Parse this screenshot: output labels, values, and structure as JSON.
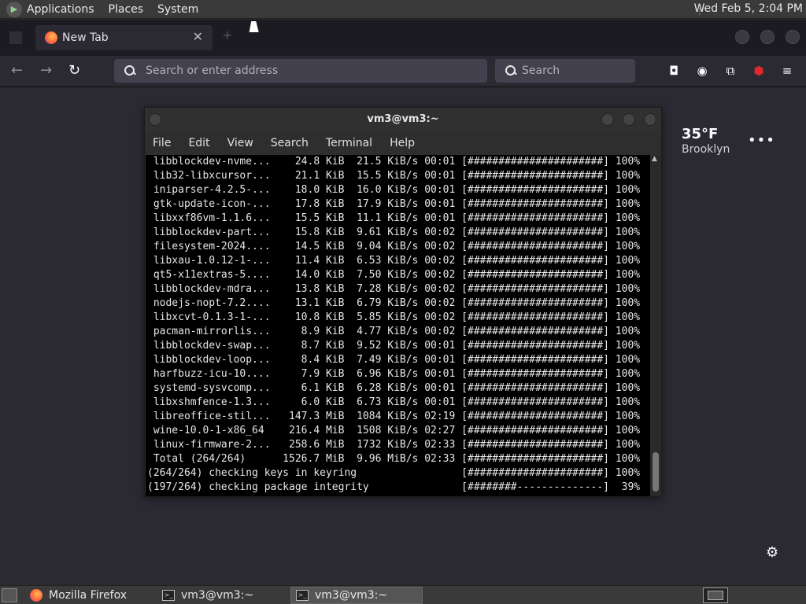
{
  "top_panel": {
    "menus": [
      "Applications",
      "Places",
      "System"
    ],
    "clock": "Wed Feb  5, 2:04 PM"
  },
  "browser": {
    "tab_title": "New Tab",
    "url_placeholder": "Search or enter address",
    "search_placeholder": "Search",
    "weather": {
      "temp": "35°F",
      "city": "Brooklyn"
    }
  },
  "terminal": {
    "title": "vm3@vm3:~",
    "menu": [
      "File",
      "Edit",
      "View",
      "Search",
      "Terminal",
      "Help"
    ],
    "lines": [
      " libblockdev-nvme...    24.8 KiB  21.5 KiB/s 00:01 [######################] 100%",
      " lib32-libxcursor...    21.1 KiB  15.5 KiB/s 00:01 [######################] 100%",
      " iniparser-4.2.5-...    18.0 KiB  16.0 KiB/s 00:01 [######################] 100%",
      " gtk-update-icon-...    17.8 KiB  17.9 KiB/s 00:01 [######################] 100%",
      " libxxf86vm-1.1.6...    15.5 KiB  11.1 KiB/s 00:01 [######################] 100%",
      " libblockdev-part...    15.8 KiB  9.61 KiB/s 00:02 [######################] 100%",
      " filesystem-2024....    14.5 KiB  9.04 KiB/s 00:02 [######################] 100%",
      " libxau-1.0.12-1-...    11.4 KiB  6.53 KiB/s 00:02 [######################] 100%",
      " qt5-x11extras-5....    14.0 KiB  7.50 KiB/s 00:02 [######################] 100%",
      " libblockdev-mdra...    13.8 KiB  7.28 KiB/s 00:02 [######################] 100%",
      " nodejs-nopt-7.2....    13.1 KiB  6.79 KiB/s 00:02 [######################] 100%",
      " libxcvt-0.1.3-1-...    10.8 KiB  5.85 KiB/s 00:02 [######################] 100%",
      " pacman-mirrorlis...     8.9 KiB  4.77 KiB/s 00:02 [######################] 100%",
      " libblockdev-swap...     8.7 KiB  9.52 KiB/s 00:01 [######################] 100%",
      " libblockdev-loop...     8.4 KiB  7.49 KiB/s 00:01 [######################] 100%",
      " harfbuzz-icu-10....     7.9 KiB  6.96 KiB/s 00:01 [######################] 100%",
      " systemd-sysvcomp...     6.1 KiB  6.28 KiB/s 00:01 [######################] 100%",
      " libxshmfence-1.3...     6.0 KiB  6.73 KiB/s 00:01 [######################] 100%",
      " libreoffice-stil...   147.3 MiB  1084 KiB/s 02:19 [######################] 100%",
      " wine-10.0-1-x86_64    216.4 MiB  1508 KiB/s 02:27 [######################] 100%",
      " linux-firmware-2...   258.6 MiB  1732 KiB/s 02:33 [######################] 100%",
      " Total (264/264)      1526.7 MiB  9.96 MiB/s 02:33 [######################] 100%",
      "(264/264) checking keys in keyring                 [######################] 100%",
      "(197/264) checking package integrity               [########--------------]  39%"
    ]
  },
  "taskbar": {
    "items": [
      "Mozilla Firefox",
      "vm3@vm3:~",
      "vm3@vm3:~"
    ]
  }
}
